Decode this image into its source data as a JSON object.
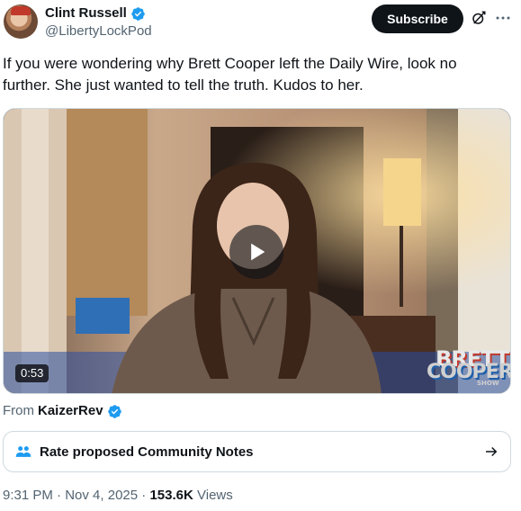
{
  "author": {
    "display_name": "Clint Russell",
    "handle": "@LibertyLockPod",
    "verified_icon": "verified-badge-icon"
  },
  "actions": {
    "subscribe_label": "Subscribe",
    "grok_icon": "grok-icon",
    "more_icon": "more-options-icon"
  },
  "tweet": {
    "text": "If you were wondering why Brett Cooper left the Daily Wire, look no further. She just wanted to tell the truth. Kudos to her."
  },
  "media": {
    "duration": "0:53",
    "play_icon": "play-icon",
    "logo_line1": "BRETT",
    "logo_line2": "COOPER",
    "logo_line3": "SHOW"
  },
  "source": {
    "prefix": "From",
    "name": "KaizerRev"
  },
  "community_notes": {
    "label": "Rate proposed Community Notes",
    "icon": "people-icon",
    "arrow_icon": "arrow-right-icon"
  },
  "meta": {
    "time": "9:31 PM",
    "separator": "·",
    "date": "Nov 4, 2025",
    "views_count": "153.6K",
    "views_label": "Views"
  },
  "colors": {
    "verified_blue": "#1d9bf0",
    "text_primary": "#0f1419",
    "text_secondary": "#536471",
    "border": "#cfd9de"
  }
}
